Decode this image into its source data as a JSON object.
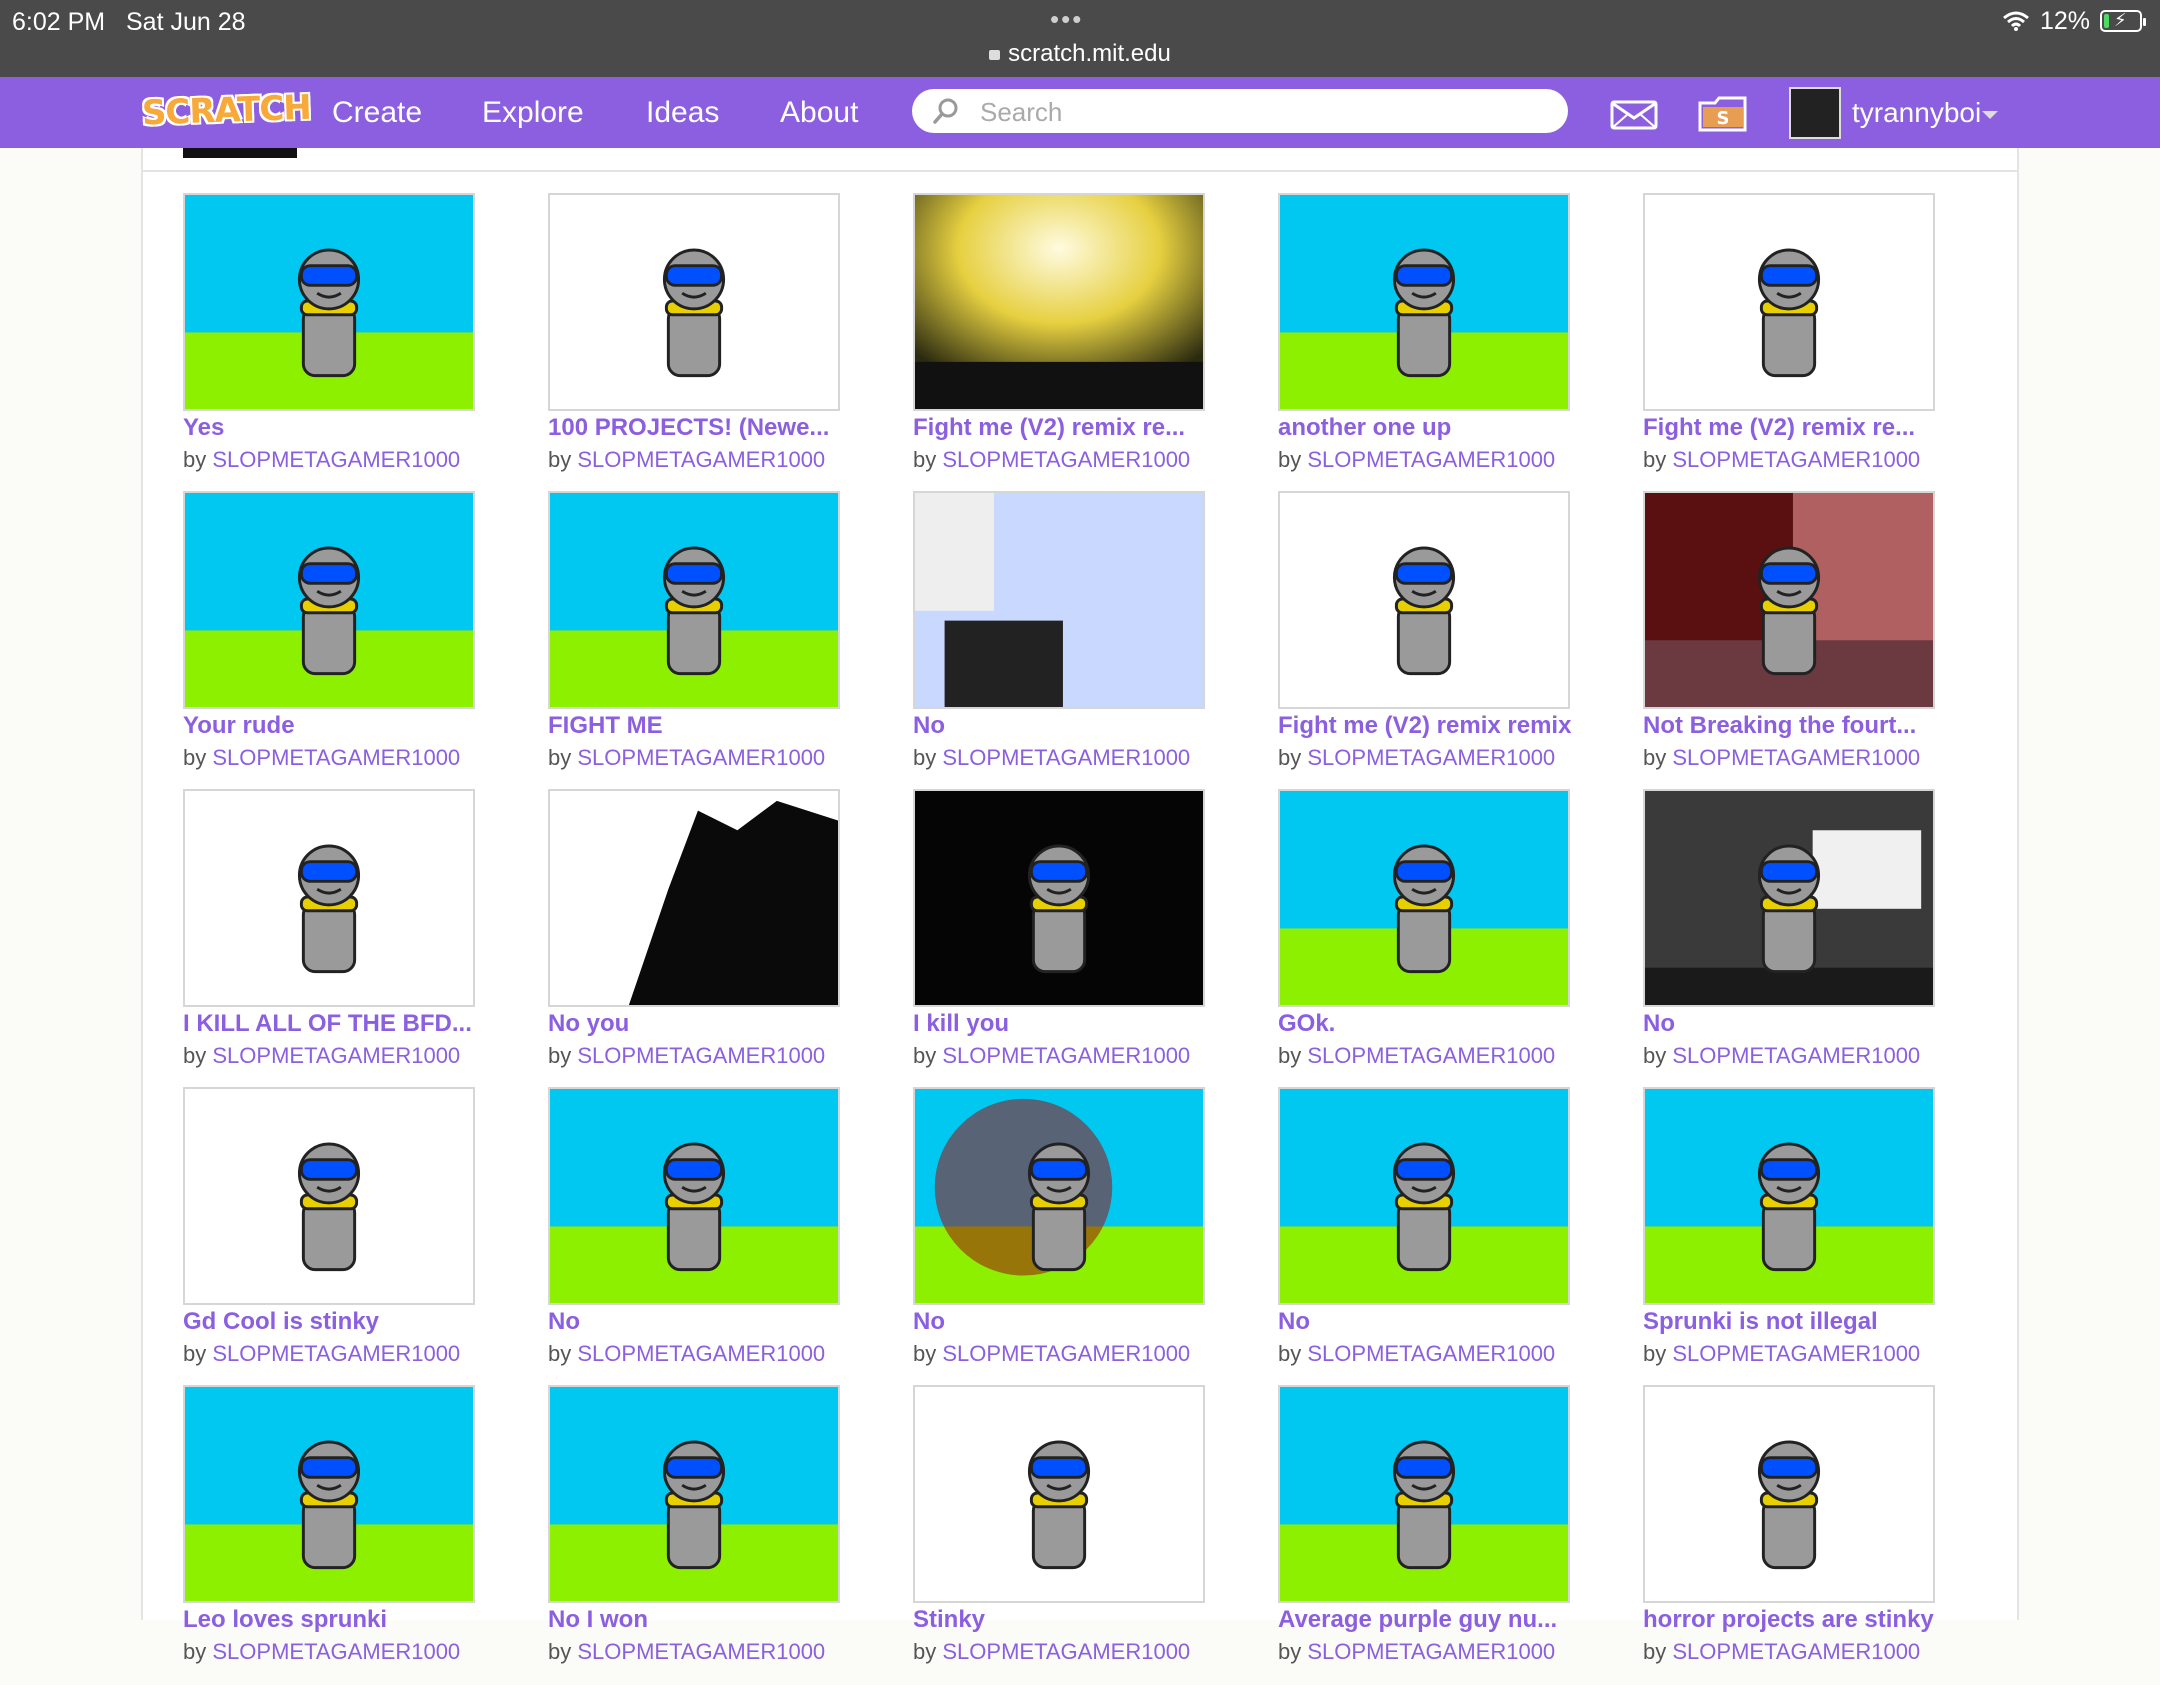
{
  "status_bar": {
    "time": "6:02 PM",
    "date": "Sat Jun 28",
    "dots": "•••",
    "url": "scratch.mit.edu",
    "battery": "12%"
  },
  "nav": {
    "logo": "SCRATCH",
    "links": [
      "Create",
      "Explore",
      "Ideas",
      "About"
    ],
    "search_placeholder": "Search",
    "username": "tyrannyboi"
  },
  "byline_prefix": "by",
  "colors": {
    "nav_purple": "#8b5fe0",
    "sky": "#00c8f0",
    "grass": "#8cf000"
  },
  "projects": [
    {
      "title": "Yes",
      "author": "SLOPMETAGAMER1000",
      "thumb": "sky"
    },
    {
      "title": "100 PROJECTS! (Newe...",
      "author": "SLOPMETAGAMER1000",
      "thumb": "white"
    },
    {
      "title": "Fight me (V2) remix re...",
      "author": "SLOPMETAGAMER1000",
      "thumb": "explosion"
    },
    {
      "title": "another one up",
      "author": "SLOPMETAGAMER1000",
      "thumb": "sky"
    },
    {
      "title": "Fight me (V2) remix re...",
      "author": "SLOPMETAGAMER1000",
      "thumb": "white"
    },
    {
      "title": "Your rude",
      "author": "SLOPMETAGAMER1000",
      "thumb": "sky"
    },
    {
      "title": "FIGHT ME",
      "author": "SLOPMETAGAMER1000",
      "thumb": "sky"
    },
    {
      "title": "No",
      "author": "SLOPMETAGAMER1000",
      "thumb": "screenshot"
    },
    {
      "title": "Fight me (V2) remix remix",
      "author": "SLOPMETAGAMER1000",
      "thumb": "white"
    },
    {
      "title": "Not Breaking the fourt...",
      "author": "SLOPMETAGAMER1000",
      "thumb": "red"
    },
    {
      "title": "I KILL ALL OF THE BFD...",
      "author": "SLOPMETAGAMER1000",
      "thumb": "white"
    },
    {
      "title": "No you",
      "author": "SLOPMETAGAMER1000",
      "thumb": "dark-splat"
    },
    {
      "title": "I kill you",
      "author": "SLOPMETAGAMER1000",
      "thumb": "black"
    },
    {
      "title": "GOk.",
      "author": "SLOPMETAGAMER1000",
      "thumb": "sky"
    },
    {
      "title": "No",
      "author": "SLOPMETAGAMER1000",
      "thumb": "laptop"
    },
    {
      "title": "Gd Cool is stinky",
      "author": "SLOPMETAGAMER1000",
      "thumb": "white"
    },
    {
      "title": "No",
      "author": "SLOPMETAGAMER1000",
      "thumb": "sky"
    },
    {
      "title": "No",
      "author": "SLOPMETAGAMER1000",
      "thumb": "blood"
    },
    {
      "title": "No",
      "author": "SLOPMETAGAMER1000",
      "thumb": "sky"
    },
    {
      "title": "Sprunki is not illegal",
      "author": "SLOPMETAGAMER1000",
      "thumb": "sky"
    },
    {
      "title": "Leo loves sprunki",
      "author": "SLOPMETAGAMER1000",
      "thumb": "sky"
    },
    {
      "title": "No I won",
      "author": "SLOPMETAGAMER1000",
      "thumb": "sky"
    },
    {
      "title": "Stinky",
      "author": "SLOPMETAGAMER1000",
      "thumb": "white"
    },
    {
      "title": "Average purple guy nu...",
      "author": "SLOPMETAGAMER1000",
      "thumb": "sky"
    },
    {
      "title": "horror projects are stinky",
      "author": "SLOPMETAGAMER1000",
      "thumb": "white"
    }
  ]
}
